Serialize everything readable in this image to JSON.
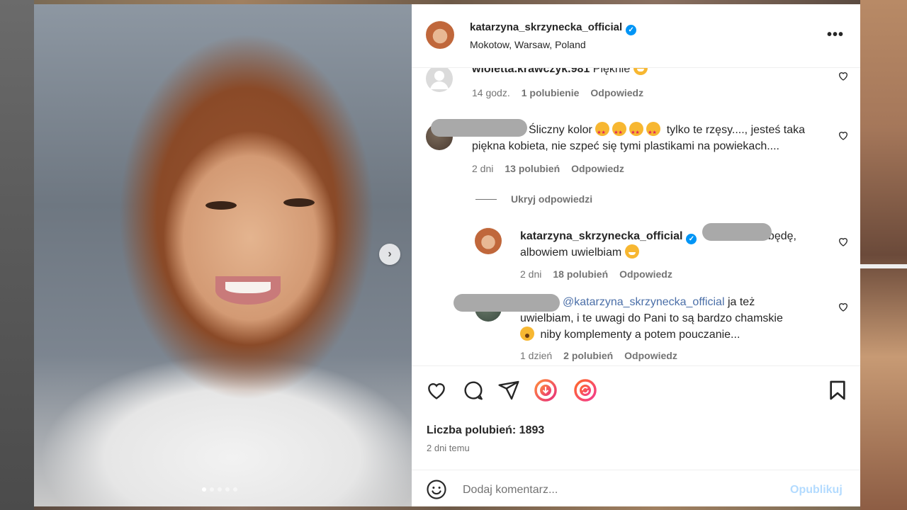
{
  "post": {
    "username": "katarzyna_skrzynecka_official",
    "location": "Mokotow, Warsaw, Poland",
    "likes_label": "Liczba polubień: 1893",
    "time_ago": "2 dni temu",
    "carousel_total": 5,
    "carousel_index": 1
  },
  "comments": [
    {
      "username": "wioletta.krawczyk.981",
      "text": "Pięknie",
      "time": "14 godz.",
      "likes": "1 polubienie",
      "reply": "Odpowiedz"
    },
    {
      "username_redacted": true,
      "text_line1": "Śliczny kolor",
      "text_line1b": "tylko te rzęsy...., jesteś taka",
      "text_line2": "piękna kobieta, nie szpeć się tymi plastikami na powiekach....",
      "time": "2 dni",
      "likes": "13 polubień",
      "reply": "Odpowiedz",
      "hide_replies": "Ukryj odpowiedzi"
    },
    {
      "username": "katarzyna_skrzynecka_official",
      "text_line1": "będę,",
      "text_line2": "albowiem uwielbiam",
      "time": "2 dni",
      "likes": "18 polubień",
      "reply": "Odpowiedz"
    },
    {
      "username_redacted": true,
      "mention": "@katarzyna_skrzynecka_official",
      "text_line1": "ja też",
      "text_line2": "uwielbiam, i te uwagi do Pani to są bardzo chamskie",
      "text_line3": "niby komplementy a potem pouczanie...",
      "time": "1 dzień",
      "likes": "2 polubień",
      "reply": "Odpowiedz"
    }
  ],
  "composer": {
    "placeholder": "Dodaj komentarz...",
    "publish": "Opublikuj"
  },
  "icons": {
    "verified": "verified-badge-icon",
    "more": "more-options-icon",
    "like": "heart-icon",
    "comment": "comment-icon",
    "share": "share-icon",
    "save": "bookmark-icon",
    "emoji": "emoji-icon",
    "next": "chevron-right-icon"
  },
  "colors": {
    "accent": "#0095f6",
    "mention": "#4b6fa8",
    "publish_disabled": "#b3dbff",
    "muted": "#737373"
  }
}
